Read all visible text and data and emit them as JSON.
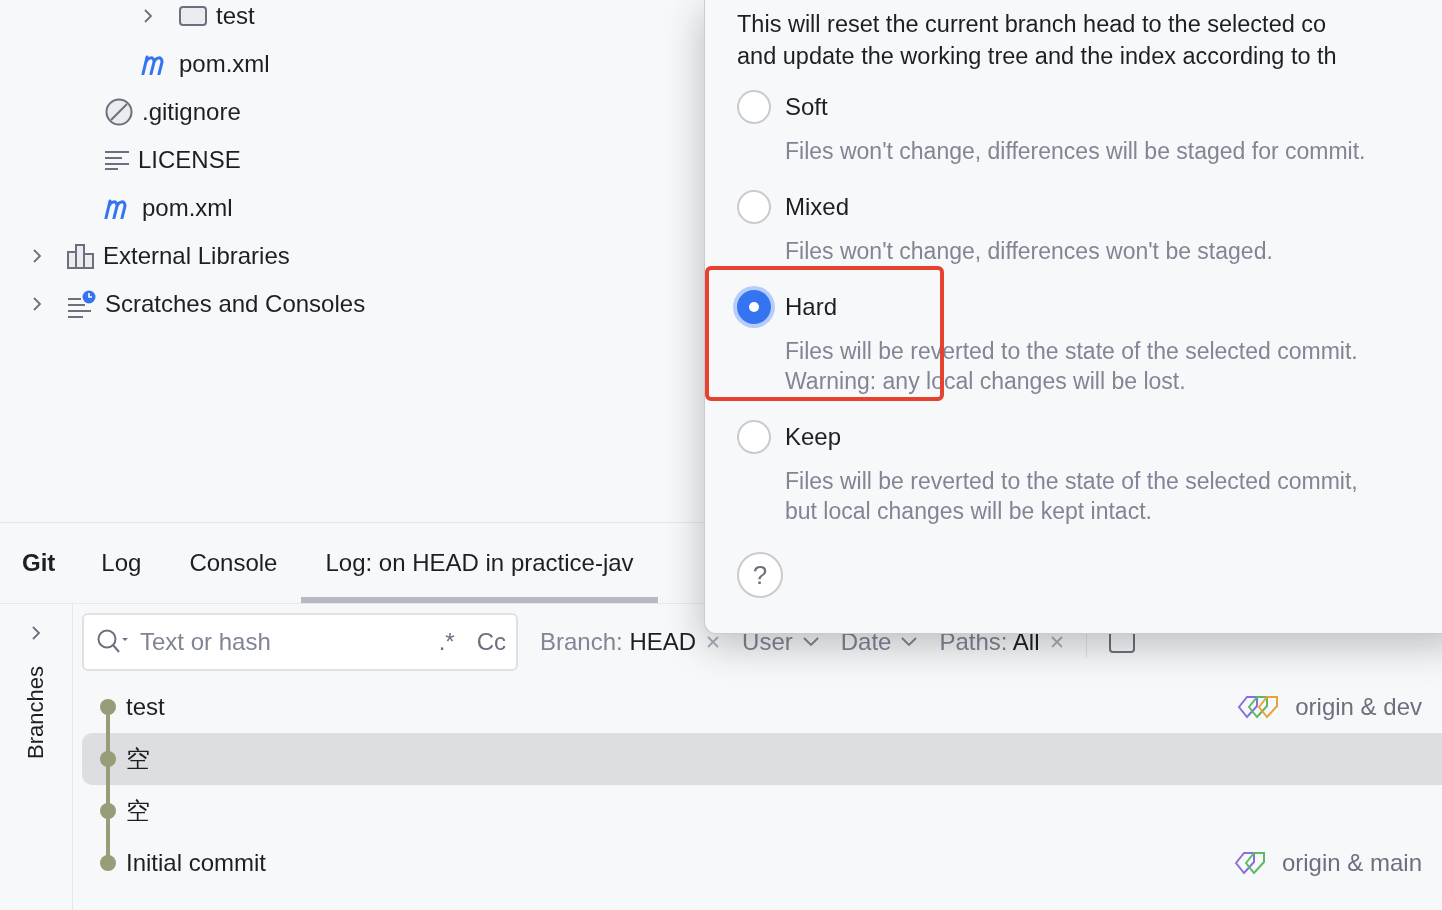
{
  "project_tree": [
    {
      "children": [
        {
          "children": [
            {
              "children": [
                {
                  "label": "test",
                  "kind": "folder",
                  "expanded": false
                }
              ]
            },
            {
              "label": "pom.xml",
              "kind": "maven"
            }
          ]
        },
        {
          "label": ".gitignore",
          "kind": "ignore"
        },
        {
          "label": "LICENSE",
          "kind": "text"
        },
        {
          "label": "pom.xml",
          "kind": "maven"
        }
      ]
    },
    {
      "label": "External Libraries",
      "kind": "library",
      "expanded": false
    },
    {
      "label": "Scratches and Consoles",
      "kind": "scratches",
      "expanded": false
    }
  ],
  "tool_window": {
    "title": "Git",
    "tabs": [
      {
        "label": "Log",
        "selected": false
      },
      {
        "label": "Console",
        "selected": false
      },
      {
        "label": "Log: on HEAD in practice-jav",
        "selected": true
      }
    ]
  },
  "side_tab": "Branches",
  "log": {
    "search": {
      "placeholder": "Text or hash",
      "regex": ".*",
      "case": "Cc"
    },
    "filters": [
      {
        "label": "Branch:",
        "value": "HEAD",
        "kind": "clear"
      },
      {
        "label": "User",
        "kind": "dropdown"
      },
      {
        "label": "Date",
        "kind": "dropdown"
      },
      {
        "label": "Paths:",
        "value": "All",
        "kind": "clear"
      }
    ],
    "commits": [
      {
        "message": "test",
        "selected": false,
        "ref": {
          "label": "origin & dev",
          "kind": "local_and_remote"
        }
      },
      {
        "message": "空",
        "selected": true
      },
      {
        "message": "空",
        "selected": false
      },
      {
        "message": "Initial commit",
        "selected": false,
        "ref": {
          "label": "origin & main",
          "kind": "remote"
        }
      }
    ]
  },
  "reset_dialog": {
    "intro": [
      "This will reset the current branch head to the selected co",
      "and update the working tree and the index according to th"
    ],
    "modes": [
      {
        "label": "Soft",
        "selected": false,
        "highlighted": false,
        "description": [
          "Files won't change, differences will be staged for commit."
        ]
      },
      {
        "label": "Mixed",
        "selected": false,
        "highlighted": false,
        "description": [
          "Files won't change, differences won't be staged."
        ]
      },
      {
        "label": "Hard",
        "selected": true,
        "highlighted": true,
        "description": [
          "Files will be reverted to the state of the selected commit.",
          "Warning: any local changes will be lost."
        ]
      },
      {
        "label": "Keep",
        "selected": false,
        "highlighted": false,
        "description": [
          "Files will be reverted to the state of the selected commit,",
          "but local changes will be kept intact."
        ]
      }
    ],
    "help": "?"
  }
}
